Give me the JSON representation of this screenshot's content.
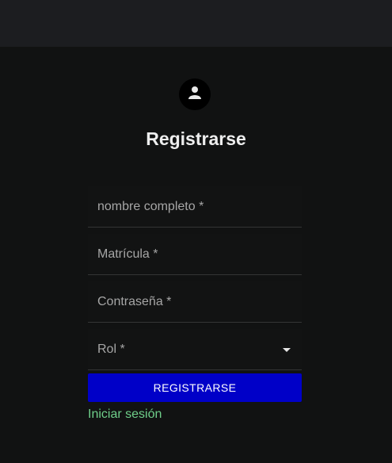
{
  "title": "Registrarse",
  "form": {
    "fullname_placeholder": "nombre completo *",
    "matricula_placeholder": "Matrícula *",
    "password_placeholder": "Contraseña *",
    "role_label": "Rol *",
    "submit_label": "REGISTRARSE"
  },
  "login_link": "Iniciar sesión",
  "colors": {
    "background": "#111212",
    "appbar": "#1c1d20",
    "button": "#0000c8",
    "link": "#6fcf8a"
  },
  "icons": {
    "avatar": "person-icon",
    "select": "caret-down-icon"
  }
}
